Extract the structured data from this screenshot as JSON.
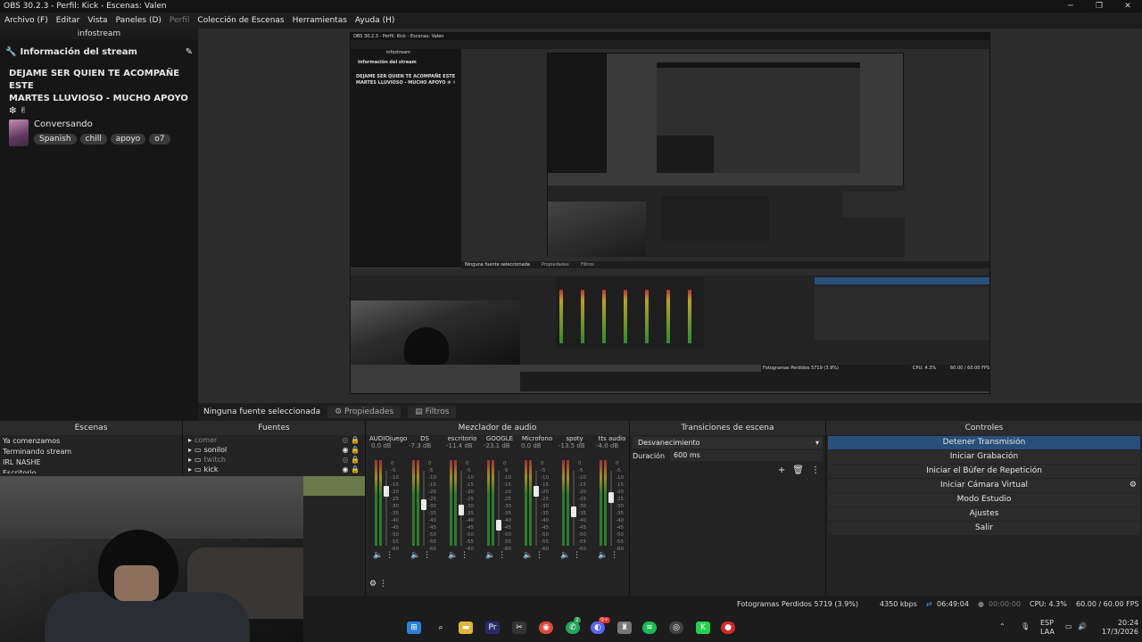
{
  "window": {
    "title": "OBS 30.2.3 - Perfil: Kick - Escenas: Valen",
    "buttons": [
      "─",
      "❐",
      "✕"
    ]
  },
  "menu": {
    "items": [
      "Archivo (F)",
      "Editar",
      "Vista",
      "Paneles (D)",
      "Perfil",
      "Colección de Escenas",
      "Herramientas",
      "Ayuda (H)"
    ]
  },
  "infostream": {
    "dock_title": "infostream",
    "header": "Información del stream",
    "stream_title_line1": "DEJAME SER QUIEN TE ACOMPAÑE ESTE",
    "stream_title_line2": "MARTES LLUVIOSO - MUCHO APOYO ❇ ✌",
    "category": "Conversando",
    "tags": [
      "Spanish",
      "chill",
      "apoyo",
      "o7"
    ]
  },
  "source_bar": {
    "no_source": "Ninguna fuente seleccionada",
    "properties": "Propiedades",
    "filters": "Filtros"
  },
  "scenes": {
    "title": "Escenas",
    "items": [
      "Ya comenzamos",
      "Terminando stream",
      "IRL NASHE",
      "Escritorio"
    ]
  },
  "sources": {
    "title": "Fuentes",
    "items": [
      {
        "name": "comer",
        "visible": false
      },
      {
        "name": "sonilol",
        "visible": true
      },
      {
        "name": "twitch",
        "visible": false
      },
      {
        "name": "kick",
        "visible": true
      }
    ]
  },
  "mixer": {
    "title": "Mezclador de audio",
    "channels": [
      {
        "name": "AUDIOjuego",
        "db": "0.0 dB",
        "level": 0.8
      },
      {
        "name": "DS",
        "db": "-7.3 dB",
        "level": 0.62
      },
      {
        "name": "escritorio",
        "db": "-11.4 dB",
        "level": 0.55
      },
      {
        "name": "GOOGLE",
        "db": "-23.1 dB",
        "level": 0.35
      },
      {
        "name": "Microfono",
        "db": "0.0 dB",
        "level": 0.8
      },
      {
        "name": "spoty",
        "db": "-13.5 dB",
        "level": 0.52
      },
      {
        "name": "tts audio",
        "db": "-4.0 dB",
        "level": 0.72
      }
    ],
    "scale": [
      "0",
      "-5",
      "-10",
      "-15",
      "-20",
      "-25",
      "-30",
      "-35",
      "-40",
      "-45",
      "-50",
      "-55",
      "-60"
    ]
  },
  "transitions": {
    "title": "Transiciones de escena",
    "selected": "Desvanecimiento",
    "duration_label": "Duración",
    "duration_value": "600 ms"
  },
  "controls": {
    "title": "Controles",
    "buttons": [
      "Detener Transmisión",
      "Iniciar Grabación",
      "Iniciar el Búfer de Repetición",
      "Iniciar Cámara Virtual",
      "Modo Estudio",
      "Ajustes",
      "Salir"
    ]
  },
  "status": {
    "dropped": "Fotogramas Perdidos 5719 (3.9%)",
    "bitrate": "4350 kbps",
    "stream_time": "06:49:04",
    "rec_time": "00:00:00",
    "cpu": "CPU: 4.3%",
    "fps": "60.00 / 60.00 FPS"
  },
  "taskbar": {
    "lang": "ESP",
    "layout": "LAA",
    "time": "20:24",
    "date": "17/3/2026",
    "badges": [
      "2",
      "9+"
    ]
  },
  "nested_preview": {
    "title": "OBS 30.2.3 - Perfil: Kick - Escenas: Valen",
    "infostream": "infostream",
    "header": "Información del stream",
    "no_source": "Ninguna fuente seleccionada",
    "properties": "Propiedades",
    "filters": "Filtros",
    "status": "Fotogramas Perdidos 5719 (3.9%)",
    "cpu": "CPU: 4.3%",
    "fps": "60.00 / 60.00 FPS"
  },
  "colors": {
    "accent": "#2a4f7a",
    "background": "#1e1e1e",
    "meter_green": "#2e8b2e",
    "meter_yellow": "#b8a028",
    "meter_red": "#b53434"
  }
}
